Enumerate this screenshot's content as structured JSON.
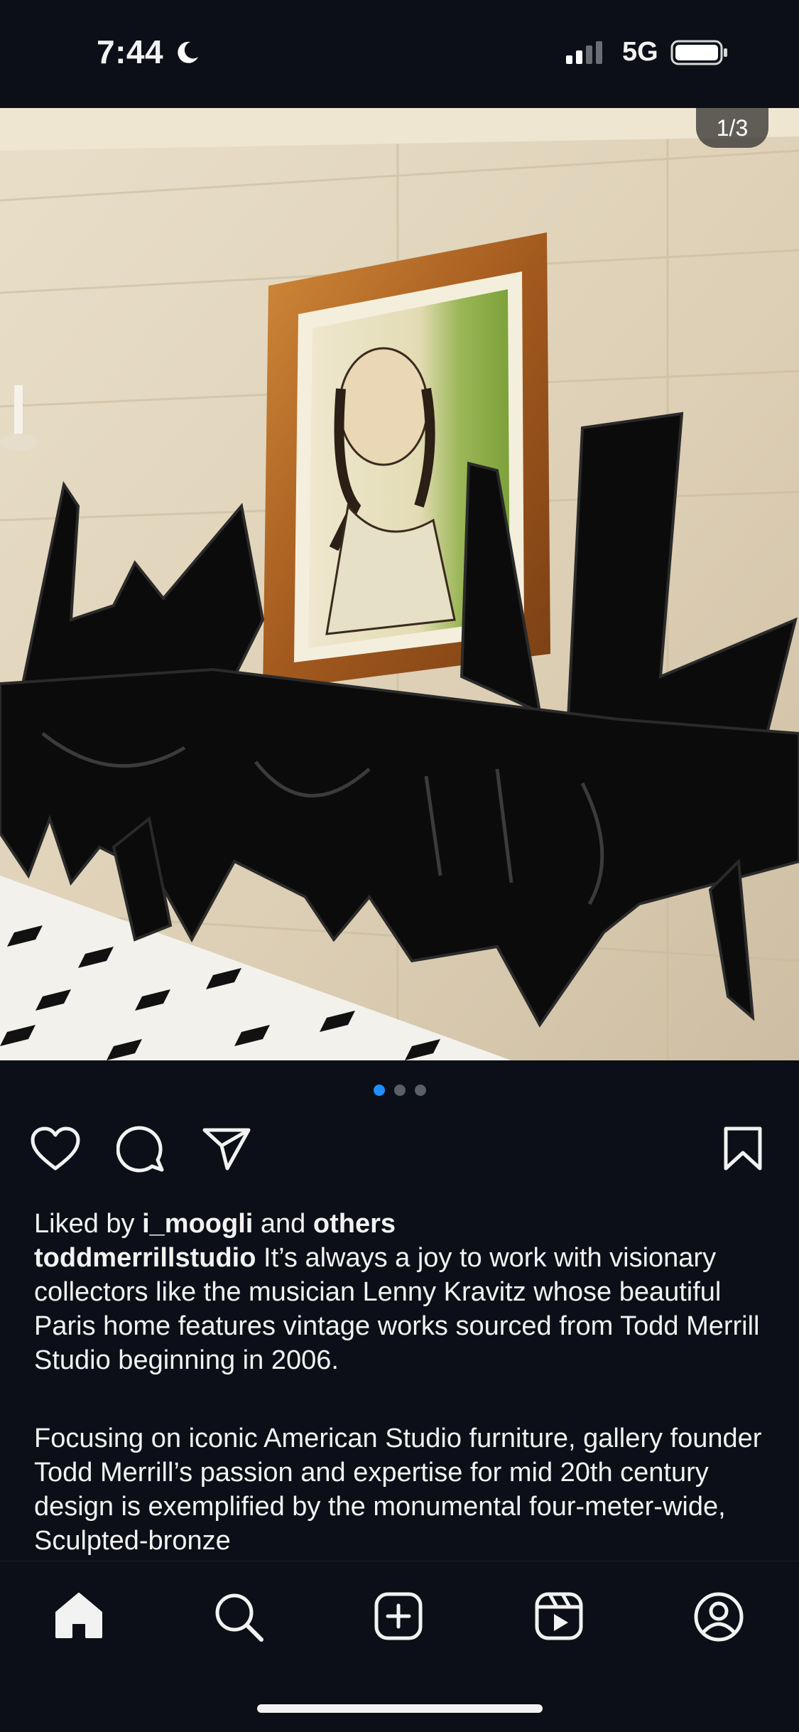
{
  "status": {
    "time": "7:44",
    "network": "5G"
  },
  "post": {
    "carousel_counter": "1/3",
    "likes": {
      "prefix": "Liked by",
      "user": "i_moogli",
      "middle": "and",
      "suffix": "others"
    },
    "author": "toddmerrillstudio",
    "caption_1": "It’s always a joy to work with visionary collectors like the musician Lenny Kravitz whose beautiful Paris home features vintage works sourced from Todd Merrill Studio beginning in 2006.",
    "caption_2": "Focusing on iconic American Studio furniture, gallery founder Todd Merrill’s passion and expertise for mid 20th century design is exemplified by the monumental four-meter-wide, Sculpted-bronze"
  },
  "icons": {
    "actions": [
      "heart-icon",
      "comment-icon",
      "share-icon",
      "bookmark-icon"
    ],
    "tabs": [
      "home-icon",
      "search-icon",
      "create-icon",
      "reels-icon",
      "profile-icon"
    ]
  },
  "colors": {
    "background": "#0c0f17",
    "active_dot": "#1f8fff",
    "text": "#f2f2f2"
  }
}
